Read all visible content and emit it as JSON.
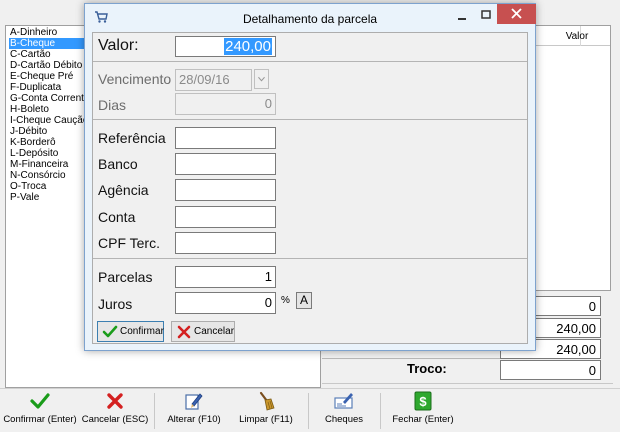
{
  "payment_methods": {
    "selected_index": 1,
    "items": [
      "A-Dinheiro",
      "B-Cheque",
      "C-Cartão",
      "D-Cartão Débito",
      "E-Cheque Pré",
      "F-Duplicata",
      "G-Conta Corrente",
      "H-Boleto",
      "I-Cheque Caução",
      "J-Débito",
      "K-Borderô",
      "L-Depósito",
      "M-Financeira",
      "N-Consórcio",
      "O-Troca",
      "P-Vale"
    ]
  },
  "grid": {
    "column_header": "Valor"
  },
  "totals": {
    "line1": "0",
    "line2": "240,00",
    "line3": "240,00",
    "troco_label": "Troco:",
    "troco_value": "0"
  },
  "toolbar": {
    "confirmar": "Confirmar (Enter)",
    "cancelar": "Cancelar (ESC)",
    "alterar": "Alterar (F10)",
    "limpar": "Limpar (F11)",
    "cheques": "Cheques",
    "fechar": "Fechar (Enter)"
  },
  "dialog": {
    "title": "Detalhamento da parcela",
    "valor_label": "Valor:",
    "valor_value": "240,00",
    "vencimento_label": "Vencimento",
    "vencimento_value": "28/09/16",
    "dias_label": "Dias",
    "dias_value": "0",
    "referencia_label": "Referência",
    "banco_label": "Banco",
    "agencia_label": "Agência",
    "conta_label": "Conta",
    "cpf_label": "CPF Terc.",
    "parcelas_label": "Parcelas",
    "parcelas_value": "1",
    "juros_label": "Juros",
    "juros_value": "0",
    "percent_sign": "%",
    "juros_button": "A",
    "confirmar_button": "Confirmar",
    "cancelar_button": "Cancelar"
  },
  "colors": {
    "selection": "#3399ff",
    "close_button": "#c75050",
    "dialog_frame": "#7da2ce",
    "confirm_green": "#1a9c1a",
    "cancel_red": "#d42020"
  }
}
